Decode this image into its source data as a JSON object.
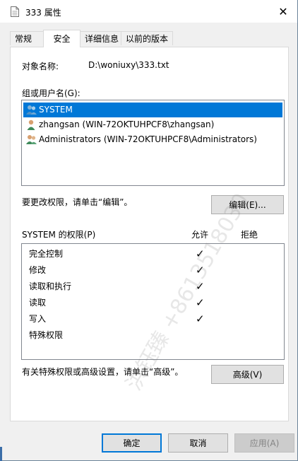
{
  "window": {
    "title": "333 属性",
    "close_glyph": "✕"
  },
  "tabs": [
    "常规",
    "安全",
    "详细信息",
    "以前的版本"
  ],
  "object": {
    "label": "对象名称:",
    "value": "D:\\woniuxy\\333.txt"
  },
  "groups": {
    "label": "组或用户名(G):",
    "items": [
      "SYSTEM",
      "zhangsan (WIN-72OKTUHPCF8\\zhangsan)",
      "Administrators (WIN-72OKTUHPCF8\\Administrators)"
    ]
  },
  "change_hint": "要更改权限，请单击“编辑”。",
  "edit_button": "编辑(E)...",
  "permissions": {
    "label": "SYSTEM 的权限(P)",
    "allow_header": "允许",
    "deny_header": "拒绝",
    "rows": [
      {
        "name": "完全控制",
        "allow": "✓",
        "deny": ""
      },
      {
        "name": "修改",
        "allow": "✓",
        "deny": ""
      },
      {
        "name": "读取和执行",
        "allow": "✓",
        "deny": ""
      },
      {
        "name": "读取",
        "allow": "✓",
        "deny": ""
      },
      {
        "name": "写入",
        "allow": "✓",
        "deny": ""
      },
      {
        "name": "特殊权限",
        "allow": "",
        "deny": ""
      }
    ]
  },
  "advanced_hint": "有关特殊权限或高级设置，请单击“高级”。",
  "advanced_button": "高级(V)",
  "footer": {
    "ok": "确定",
    "cancel": "取消",
    "apply": "应用(A)"
  },
  "watermark": "洪钰臻 +8613518030"
}
